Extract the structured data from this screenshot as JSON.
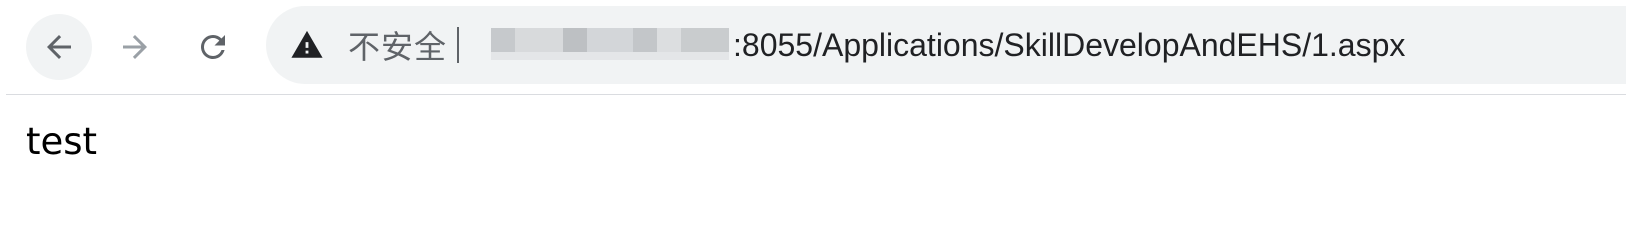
{
  "toolbar": {
    "back_icon": "arrow-left-icon",
    "forward_icon": "arrow-right-icon",
    "reload_icon": "reload-icon"
  },
  "omnibox": {
    "security_icon": "warning-triangle-icon",
    "security_label": "不安全",
    "url_visible": ":8055/Applications/SkillDevelopAndEHS/1.aspx"
  },
  "page": {
    "body_text": "test"
  },
  "colors": {
    "toolbar_bg": "#ffffff",
    "omnibox_bg": "#f1f3f4",
    "icon_color": "#5f6368",
    "disabled_icon": "#9aa0a6",
    "url_text": "#202124"
  }
}
